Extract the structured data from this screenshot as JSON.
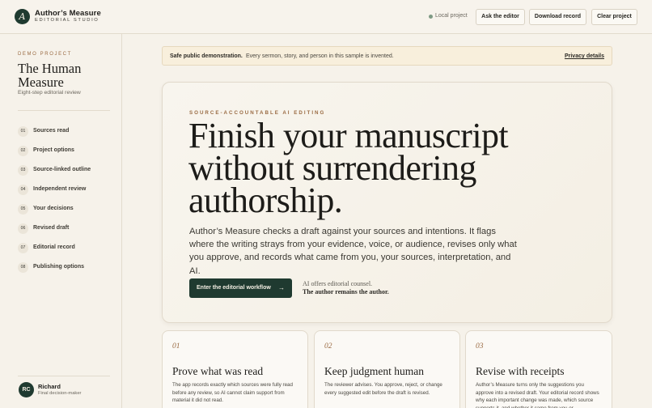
{
  "header": {
    "logo_letter": "A",
    "brand_name": "Author’s Measure",
    "brand_sub": "EDITORIAL STUDIO",
    "local_label": "Local project",
    "ask_label": "Ask the editor",
    "download_label": "Download record",
    "clear_label": "Clear project"
  },
  "sidebar": {
    "kicker": "DEMO PROJECT",
    "project_title": "The Human Measure",
    "project_sub": "Eight-step editorial review",
    "steps": [
      {
        "num": "01",
        "label": "Sources read"
      },
      {
        "num": "02",
        "label": "Project options"
      },
      {
        "num": "03",
        "label": "Source-linked outline"
      },
      {
        "num": "04",
        "label": "Independent review"
      },
      {
        "num": "05",
        "label": "Your decisions"
      },
      {
        "num": "06",
        "label": "Revised draft"
      },
      {
        "num": "07",
        "label": "Editorial record"
      },
      {
        "num": "08",
        "label": "Publishing options"
      }
    ],
    "user": {
      "initials": "RC",
      "name": "Richard",
      "role": "Final decision-maker"
    }
  },
  "notice": {
    "strong": "Safe public demonstration.",
    "text": "Every sermon, story, and person in this sample is invented.",
    "link": "Privacy details"
  },
  "hero": {
    "kicker": "SOURCE-ACCOUNTABLE AI EDITING",
    "title": "Finish your manuscript without surrendering authorship.",
    "body": "Author’s Measure checks a draft against your sources and intentions. It flags where the writing strays from your evidence, voice, or audience, revises only what you approve, and records what came from you, your sources, interpretation, and AI.",
    "cta_label": "Enter the editorial workflow",
    "cta_arrow": "→",
    "note1": "AI offers editorial counsel.",
    "note2": "The author remains the author."
  },
  "cards": [
    {
      "num": "01",
      "title": "Prove what was read",
      "body": "The app records exactly which sources were fully read before any review, so AI cannot claim support from material it did not read."
    },
    {
      "num": "02",
      "title": "Keep judgment human",
      "body": "The reviewer advises. You approve, reject, or change every suggested edit before the draft is revised."
    },
    {
      "num": "03",
      "title": "Revise with receipts",
      "body": "Author’s Measure turns only the suggestions you approve into a revised draft. Your editorial record shows why each important change was made, which source supports it, and whether it came from you or"
    }
  ],
  "colors": {
    "accent_green": "#1f3a30",
    "accent_bronze": "#9a6b43",
    "background": "#f6f2ea",
    "notice_bg": "#f8efdc"
  }
}
